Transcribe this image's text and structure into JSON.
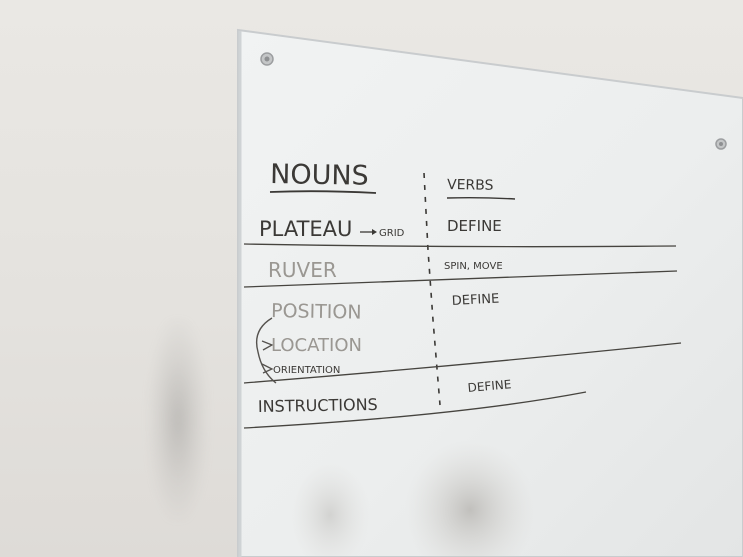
{
  "whiteboard": {
    "nouns_header": "NOUNS",
    "verbs_header": "VERBS",
    "rows": [
      {
        "noun": "PLATEAU",
        "noun_note": "GRID",
        "verb": "DEFINE"
      },
      {
        "noun": "RUVER",
        "verb": "SPIN, MOVE"
      },
      {
        "noun": "POSITION",
        "noun_sub1": "LOCATION",
        "noun_sub2": "ORIENTATION",
        "verb": "DEFINE"
      },
      {
        "noun": "INSTRUCTIONS",
        "verb": "DEFINE"
      }
    ]
  },
  "colors": {
    "wall": "#e6e4e0",
    "glass": "#eef1f2",
    "marker": "#3b3936"
  }
}
